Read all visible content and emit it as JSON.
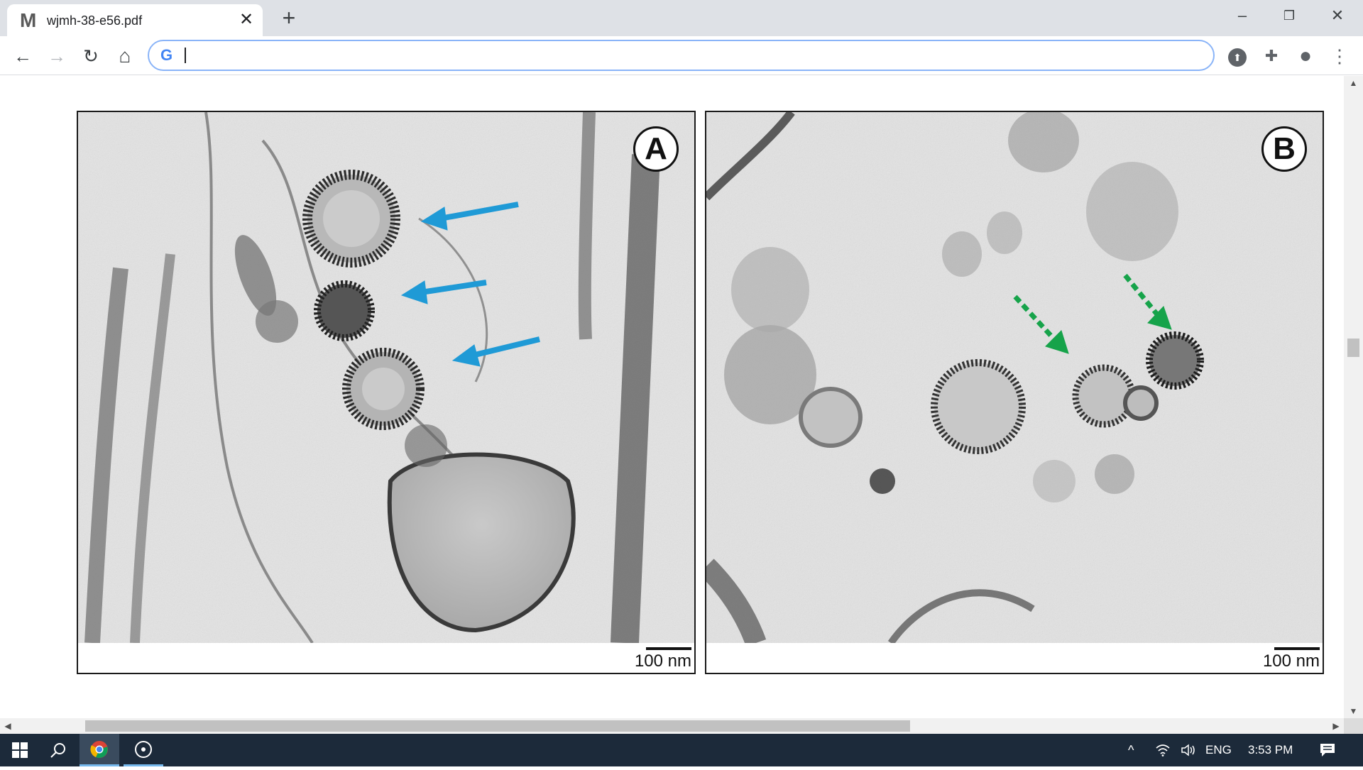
{
  "browser": {
    "tab": {
      "title": "wjmh-38-e56.pdf",
      "favicon_letter": "M",
      "close_glyph": "✕"
    },
    "new_tab_glyph": "+",
    "window_controls": {
      "minimize": "–",
      "maximize": "❐",
      "close": "✕"
    },
    "toolbar": {
      "back_glyph": "←",
      "forward_glyph": "→",
      "reload_glyph": "↻",
      "home_glyph": "⌂",
      "omnibox": {
        "value": "",
        "search_engine_glyph": "G"
      },
      "extension_glyph": "⬆",
      "puzzle_glyph": "✚",
      "profile_glyph": "●",
      "menu_glyph": "⋮"
    }
  },
  "figure": {
    "panels": [
      {
        "label": "A",
        "scale_label": "100 nm"
      },
      {
        "label": "B",
        "scale_label": "100 nm"
      }
    ],
    "arrow_colors": {
      "panel_a": "#1f9ad6",
      "panel_b": "#16a34a"
    }
  },
  "scrollbars": {
    "up": "▲",
    "down": "▼",
    "left": "◀",
    "right": "▶"
  },
  "taskbar": {
    "start_icon": "windows-logo",
    "search_icon": "search",
    "language": "ENG",
    "time": "3:53 PM",
    "tray_up_glyph": "^",
    "notification_glyph": "▤"
  }
}
